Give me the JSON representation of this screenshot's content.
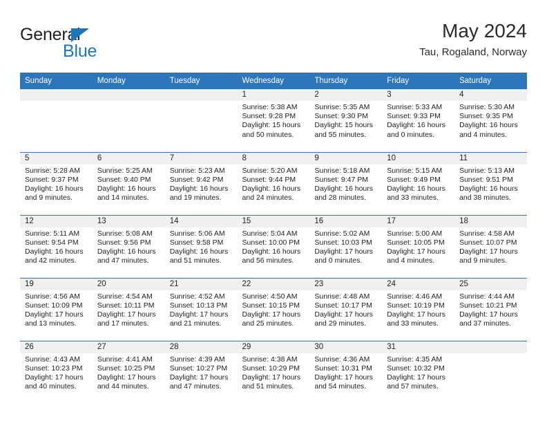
{
  "brand": {
    "name_top": "General",
    "name_bottom": "Blue",
    "accent_color": "#1c76bc",
    "logo_icon": "triangle-flag-icon"
  },
  "header": {
    "title": "May 2024",
    "subtitle": "Tau, Rogaland, Norway"
  },
  "theme": {
    "header_blue": "#2e76bc",
    "date_strip_gray": "#f0f0f0",
    "text": "#222222"
  },
  "calendar": {
    "weekday_headers": [
      "Sunday",
      "Monday",
      "Tuesday",
      "Wednesday",
      "Thursday",
      "Friday",
      "Saturday"
    ],
    "weeks": [
      [
        {
          "date": "",
          "empty": true,
          "lines": []
        },
        {
          "date": "",
          "empty": true,
          "lines": []
        },
        {
          "date": "",
          "empty": true,
          "lines": []
        },
        {
          "date": "1",
          "empty": false,
          "lines": [
            "Sunrise: 5:38 AM",
            "Sunset: 9:28 PM",
            "Daylight: 15 hours",
            "and 50 minutes."
          ]
        },
        {
          "date": "2",
          "empty": false,
          "lines": [
            "Sunrise: 5:35 AM",
            "Sunset: 9:30 PM",
            "Daylight: 15 hours",
            "and 55 minutes."
          ]
        },
        {
          "date": "3",
          "empty": false,
          "lines": [
            "Sunrise: 5:33 AM",
            "Sunset: 9:33 PM",
            "Daylight: 16 hours",
            "and 0 minutes."
          ]
        },
        {
          "date": "4",
          "empty": false,
          "lines": [
            "Sunrise: 5:30 AM",
            "Sunset: 9:35 PM",
            "Daylight: 16 hours",
            "and 4 minutes."
          ]
        }
      ],
      [
        {
          "date": "5",
          "empty": false,
          "lines": [
            "Sunrise: 5:28 AM",
            "Sunset: 9:37 PM",
            "Daylight: 16 hours",
            "and 9 minutes."
          ]
        },
        {
          "date": "6",
          "empty": false,
          "lines": [
            "Sunrise: 5:25 AM",
            "Sunset: 9:40 PM",
            "Daylight: 16 hours",
            "and 14 minutes."
          ]
        },
        {
          "date": "7",
          "empty": false,
          "lines": [
            "Sunrise: 5:23 AM",
            "Sunset: 9:42 PM",
            "Daylight: 16 hours",
            "and 19 minutes."
          ]
        },
        {
          "date": "8",
          "empty": false,
          "lines": [
            "Sunrise: 5:20 AM",
            "Sunset: 9:44 PM",
            "Daylight: 16 hours",
            "and 24 minutes."
          ]
        },
        {
          "date": "9",
          "empty": false,
          "lines": [
            "Sunrise: 5:18 AM",
            "Sunset: 9:47 PM",
            "Daylight: 16 hours",
            "and 28 minutes."
          ]
        },
        {
          "date": "10",
          "empty": false,
          "lines": [
            "Sunrise: 5:15 AM",
            "Sunset: 9:49 PM",
            "Daylight: 16 hours",
            "and 33 minutes."
          ]
        },
        {
          "date": "11",
          "empty": false,
          "lines": [
            "Sunrise: 5:13 AM",
            "Sunset: 9:51 PM",
            "Daylight: 16 hours",
            "and 38 minutes."
          ]
        }
      ],
      [
        {
          "date": "12",
          "empty": false,
          "lines": [
            "Sunrise: 5:11 AM",
            "Sunset: 9:54 PM",
            "Daylight: 16 hours",
            "and 42 minutes."
          ]
        },
        {
          "date": "13",
          "empty": false,
          "lines": [
            "Sunrise: 5:08 AM",
            "Sunset: 9:56 PM",
            "Daylight: 16 hours",
            "and 47 minutes."
          ]
        },
        {
          "date": "14",
          "empty": false,
          "lines": [
            "Sunrise: 5:06 AM",
            "Sunset: 9:58 PM",
            "Daylight: 16 hours",
            "and 51 minutes."
          ]
        },
        {
          "date": "15",
          "empty": false,
          "lines": [
            "Sunrise: 5:04 AM",
            "Sunset: 10:00 PM",
            "Daylight: 16 hours",
            "and 56 minutes."
          ]
        },
        {
          "date": "16",
          "empty": false,
          "lines": [
            "Sunrise: 5:02 AM",
            "Sunset: 10:03 PM",
            "Daylight: 17 hours",
            "and 0 minutes."
          ]
        },
        {
          "date": "17",
          "empty": false,
          "lines": [
            "Sunrise: 5:00 AM",
            "Sunset: 10:05 PM",
            "Daylight: 17 hours",
            "and 4 minutes."
          ]
        },
        {
          "date": "18",
          "empty": false,
          "lines": [
            "Sunrise: 4:58 AM",
            "Sunset: 10:07 PM",
            "Daylight: 17 hours",
            "and 9 minutes."
          ]
        }
      ],
      [
        {
          "date": "19",
          "empty": false,
          "lines": [
            "Sunrise: 4:56 AM",
            "Sunset: 10:09 PM",
            "Daylight: 17 hours",
            "and 13 minutes."
          ]
        },
        {
          "date": "20",
          "empty": false,
          "lines": [
            "Sunrise: 4:54 AM",
            "Sunset: 10:11 PM",
            "Daylight: 17 hours",
            "and 17 minutes."
          ]
        },
        {
          "date": "21",
          "empty": false,
          "lines": [
            "Sunrise: 4:52 AM",
            "Sunset: 10:13 PM",
            "Daylight: 17 hours",
            "and 21 minutes."
          ]
        },
        {
          "date": "22",
          "empty": false,
          "lines": [
            "Sunrise: 4:50 AM",
            "Sunset: 10:15 PM",
            "Daylight: 17 hours",
            "and 25 minutes."
          ]
        },
        {
          "date": "23",
          "empty": false,
          "lines": [
            "Sunrise: 4:48 AM",
            "Sunset: 10:17 PM",
            "Daylight: 17 hours",
            "and 29 minutes."
          ]
        },
        {
          "date": "24",
          "empty": false,
          "lines": [
            "Sunrise: 4:46 AM",
            "Sunset: 10:19 PM",
            "Daylight: 17 hours",
            "and 33 minutes."
          ]
        },
        {
          "date": "25",
          "empty": false,
          "lines": [
            "Sunrise: 4:44 AM",
            "Sunset: 10:21 PM",
            "Daylight: 17 hours",
            "and 37 minutes."
          ]
        }
      ],
      [
        {
          "date": "26",
          "empty": false,
          "lines": [
            "Sunrise: 4:43 AM",
            "Sunset: 10:23 PM",
            "Daylight: 17 hours",
            "and 40 minutes."
          ]
        },
        {
          "date": "27",
          "empty": false,
          "lines": [
            "Sunrise: 4:41 AM",
            "Sunset: 10:25 PM",
            "Daylight: 17 hours",
            "and 44 minutes."
          ]
        },
        {
          "date": "28",
          "empty": false,
          "lines": [
            "Sunrise: 4:39 AM",
            "Sunset: 10:27 PM",
            "Daylight: 17 hours",
            "and 47 minutes."
          ]
        },
        {
          "date": "29",
          "empty": false,
          "lines": [
            "Sunrise: 4:38 AM",
            "Sunset: 10:29 PM",
            "Daylight: 17 hours",
            "and 51 minutes."
          ]
        },
        {
          "date": "30",
          "empty": false,
          "lines": [
            "Sunrise: 4:36 AM",
            "Sunset: 10:31 PM",
            "Daylight: 17 hours",
            "and 54 minutes."
          ]
        },
        {
          "date": "31",
          "empty": false,
          "lines": [
            "Sunrise: 4:35 AM",
            "Sunset: 10:32 PM",
            "Daylight: 17 hours",
            "and 57 minutes."
          ]
        },
        {
          "date": "",
          "empty": true,
          "lines": []
        }
      ]
    ]
  }
}
